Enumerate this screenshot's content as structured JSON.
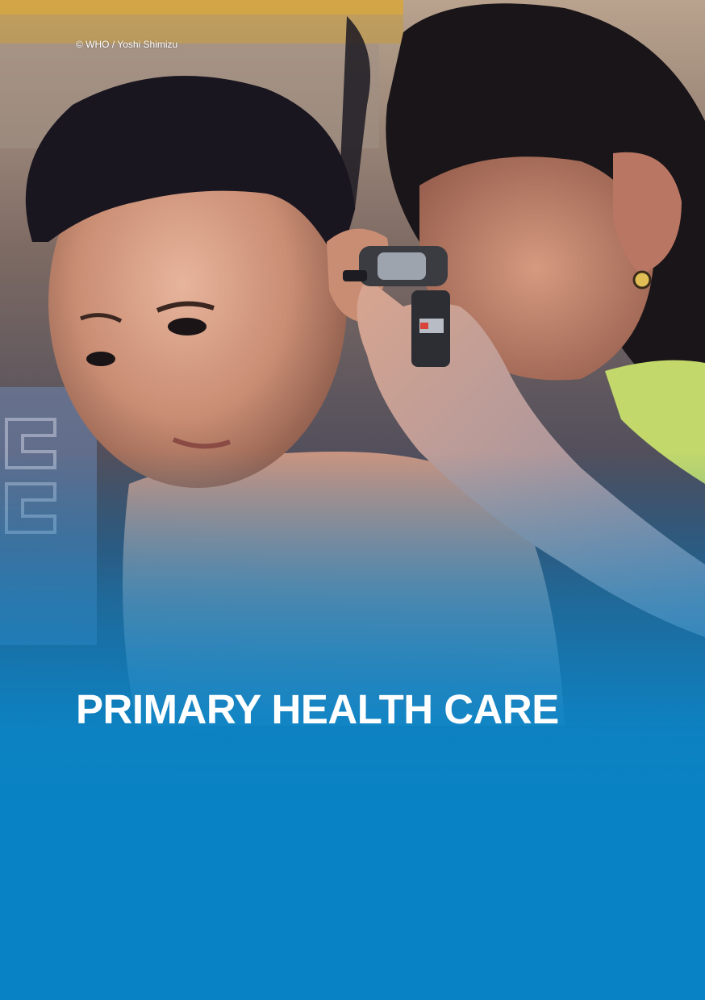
{
  "photo": {
    "credit": "© WHO / Yoshi Shimizu"
  },
  "cover": {
    "title": "PRIMARY HEALTH CARE"
  },
  "colors": {
    "brand_blue": "#0a86c8",
    "title_text": "#ffffff"
  }
}
